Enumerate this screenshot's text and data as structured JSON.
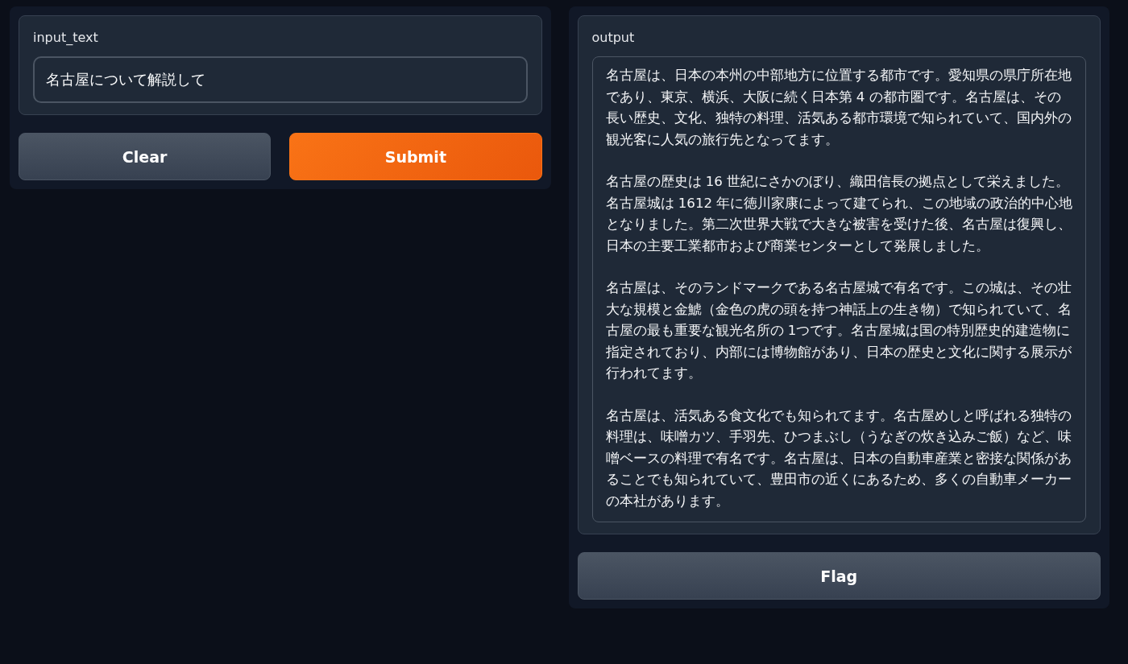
{
  "input_panel": {
    "label": "input_text",
    "value": "名古屋について解説して"
  },
  "buttons": [
    {
      "label": "Clear",
      "kind": "secondary"
    },
    {
      "label": "Submit",
      "kind": "primary"
    }
  ],
  "output_panel": {
    "label": "output",
    "paragraphs": [
      "名古屋は、日本の本州の中部地方に位置する都市です。愛知県の県庁所在地であり、東京、横浜、大阪に続く日本第 4 の都市圏です。名古屋は、その長い歴史、文化、独特の料理、活気ある都市環境で知られていて、国内外の観光客に人気の旅行先となってます。",
      "名古屋の歴史は 16 世紀にさかのぼり、織田信長の拠点として栄えました。名古屋城は 1612 年に徳川家康によって建てられ、この地域の政治的中心地となりました。第二次世界大戦で大きな被害を受けた後、名古屋は復興し、日本の主要工業都市および商業センターとして発展しました。",
      "名古屋は、そのランドマークである名古屋城で有名です。この城は、その壮大な規模と金鯱（金色の虎の頭を持つ神話上の生き物）で知られていて、名古屋の最も重要な観光名所の 1つです。名古屋城は国の特別歴史的建造物に指定されており、内部には博物館があり、日本の歴史と文化に関する展示が行われてます。",
      "名古屋は、活気ある食文化でも知られてます。名古屋めしと呼ばれる独特の料理は、味噌カツ、手羽先、ひつまぶし（うなぎの炊き込みご飯）など、味噌ベースの料理で有名です。名古屋は、日本の自動車産業と密接な関係があることでも知られていて、豊田市の近くにあるため、多くの自動車メーカーの本社があります。"
    ]
  },
  "flag_button": {
    "label": "Flag"
  }
}
